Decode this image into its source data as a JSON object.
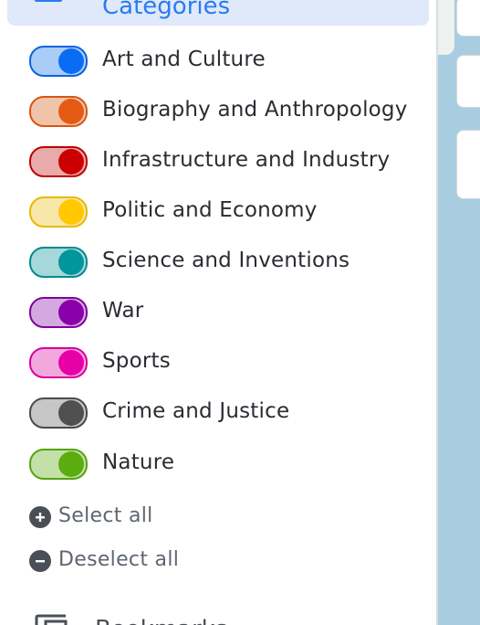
{
  "header": {
    "label": "Categories",
    "icon": "grid-icon",
    "color": "#2a7bf0"
  },
  "categories": [
    {
      "label": "Art and Culture",
      "enabled": true,
      "color": "#0a6cf5",
      "track": "#a9cdf7",
      "border": "#0a63e0"
    },
    {
      "label": "Biography and Anthropology",
      "enabled": true,
      "color": "#e55a12",
      "track": "#f0c3ab",
      "border": "#d8560f"
    },
    {
      "label": "Infrastructure and Industry",
      "enabled": true,
      "color": "#cc0000",
      "track": "#e8aaaa",
      "border": "#c00000"
    },
    {
      "label": "Politic and Economy",
      "enabled": true,
      "color": "#ffc800",
      "track": "#f7e7a9",
      "border": "#e9b800"
    },
    {
      "label": "Science and Inventions",
      "enabled": true,
      "color": "#00969b",
      "track": "#a6d7d9",
      "border": "#008b8f"
    },
    {
      "label": "War",
      "enabled": true,
      "color": "#8a00a8",
      "track": "#d4a9df",
      "border": "#8000a0"
    },
    {
      "label": "Sports",
      "enabled": true,
      "color": "#e600a6",
      "track": "#f2a8dd",
      "border": "#d8009a"
    },
    {
      "label": "Crime and Justice",
      "enabled": true,
      "color": "#505050",
      "track": "#c6c6c6",
      "border": "#4a4a4a"
    },
    {
      "label": "Nature",
      "enabled": true,
      "color": "#5aad0d",
      "track": "#c3e0a9",
      "border": "#55a40c"
    }
  ],
  "actions": {
    "select_all": "Select all",
    "deselect_all": "Deselect all"
  },
  "next_section": {
    "label": "Bookmarks",
    "icon": "bookmark-icon"
  }
}
